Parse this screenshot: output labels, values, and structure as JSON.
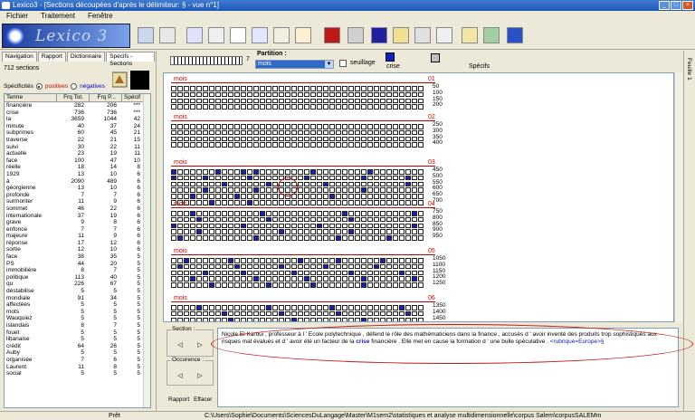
{
  "window": {
    "title": "Lexico3 - [Sections  découpées d'après le délimiteur: § - vue n°1]"
  },
  "menu": [
    "Fichier",
    "Traitement",
    "Fenêtre"
  ],
  "logo": "Lexico 3",
  "side": {
    "tabs": [
      "Navigation",
      "Rapport",
      "Dictionnaire",
      "Spécifs - Sections"
    ],
    "count": "712 sections",
    "spec_label": "Spécificités",
    "positive": "positives",
    "negative": "négatives",
    "headers": [
      "Terme",
      "Frq Tot.",
      "Frq P...",
      "Spécif"
    ],
    "rows": [
      [
        "financière",
        "282",
        "206",
        "***"
      ],
      [
        "crise",
        "736",
        "736",
        "***"
      ],
      [
        "la",
        "3659",
        "1044",
        "42"
      ],
      [
        "minute",
        "40",
        "37",
        "24"
      ],
      [
        "subprimes",
        "60",
        "45",
        "21"
      ],
      [
        "traverse",
        "22",
        "21",
        "15"
      ],
      [
        "suivi",
        "30",
        "22",
        "11"
      ],
      [
        "actuelle",
        "23",
        "19",
        "11"
      ],
      [
        "face",
        "100",
        "47",
        "10"
      ],
      [
        "réelle",
        "18",
        "14",
        "8"
      ],
      [
        "1929",
        "13",
        "10",
        "6"
      ],
      [
        "à",
        "2090",
        "489",
        "6"
      ],
      [
        "géorgienne",
        "13",
        "10",
        "6"
      ],
      [
        "profonde",
        "7",
        "7",
        "6"
      ],
      [
        "surmonter",
        "11",
        "9",
        "6"
      ],
      [
        "sommet",
        "46",
        "22",
        "6"
      ],
      [
        "internationale",
        "37",
        "19",
        "6"
      ],
      [
        "grave",
        "9",
        "8",
        "6"
      ],
      [
        "enfonce",
        "7",
        "7",
        "6"
      ],
      [
        "majeure",
        "11",
        "9",
        "6"
      ],
      [
        "réponse",
        "17",
        "12",
        "6"
      ],
      [
        "sortie",
        "12",
        "10",
        "6"
      ],
      [
        "face",
        "38",
        "35",
        "5"
      ],
      [
        "PS",
        "44",
        "20",
        "5"
      ],
      [
        "immobilière",
        "8",
        "7",
        "5"
      ],
      [
        "politique",
        "113",
        "40",
        "5"
      ],
      [
        "qu",
        "226",
        "67",
        "5"
      ],
      [
        "déstabilise",
        "5",
        "5",
        "5"
      ],
      [
        "mondiale",
        "91",
        "34",
        "5"
      ],
      [
        "affectées",
        "5",
        "5",
        "5"
      ],
      [
        "mots",
        "5",
        "5",
        "5"
      ],
      [
        "Wauquiez",
        "5",
        "5",
        "5"
      ],
      [
        "islandais",
        "8",
        "7",
        "5"
      ],
      [
        "fouet",
        "5",
        "5",
        "5"
      ],
      [
        "libanaise",
        "5",
        "5",
        "5"
      ],
      [
        "crédit",
        "64",
        "26",
        "5"
      ],
      [
        "Auby",
        "5",
        "5",
        "5"
      ],
      [
        "organisée",
        "7",
        "6",
        "5"
      ],
      [
        "Laurent",
        "11",
        "8",
        "5"
      ],
      [
        "social",
        "5",
        "5",
        "5"
      ]
    ]
  },
  "controls": {
    "partition_label": "Partition :",
    "partition_value": "mois",
    "ruler_value": "7",
    "seuillage": "seuillage",
    "crise": "crise",
    "specifs": "Spécifs"
  },
  "months": [
    {
      "name": "mois",
      "num": "01",
      "labels": [
        "50",
        "100",
        "150",
        "200"
      ],
      "blue": []
    },
    {
      "name": "mois",
      "num": "02",
      "labels": [
        "250",
        "300",
        "350",
        "400"
      ],
      "blue": []
    },
    {
      "name": "mois",
      "num": "03",
      "labels": [
        "450",
        "500",
        "550",
        "600",
        "650",
        "700"
      ],
      "blue": [
        0,
        7,
        11,
        13,
        22,
        31,
        40,
        45,
        52,
        61,
        70,
        77,
        88,
        95,
        104,
        117,
        125,
        133,
        150,
        163,
        170,
        185,
        206,
        212
      ]
    },
    {
      "name": "mois",
      "num": "04",
      "labels": [
        "750",
        "800",
        "850",
        "900",
        "950"
      ],
      "blue": [
        3,
        14,
        27,
        38,
        44,
        55,
        68,
        80,
        91,
        103,
        118,
        124,
        137,
        148,
        161,
        173,
        186,
        194
      ]
    },
    {
      "name": "mois",
      "num": "05",
      "labels": [
        "1050",
        "1100",
        "1150",
        "1200",
        "1250"
      ],
      "blue": [
        2,
        9,
        20,
        26,
        33,
        41,
        50,
        57,
        64,
        72,
        85,
        91,
        99,
        108,
        116,
        123,
        133,
        141,
        150,
        158,
        166,
        175,
        182,
        190
      ]
    },
    {
      "name": "mois",
      "num": "06",
      "labels": [
        "1350",
        "1400",
        "1450"
      ],
      "blue": [
        4,
        15,
        25,
        36,
        48,
        57,
        66,
        77,
        89,
        99,
        110
      ]
    }
  ],
  "bottom": {
    "section_label": "Section :",
    "occ_label": "Occurence :",
    "rapport": "Rapport",
    "effacer": "Effacer",
    "context_before": "Nicole El Karoui , professeur à l ' Ecole polytechnique , défend le rôle des mathématiciens dans la finance , accusés d ' avoir inventé des produits trop sophistiqués aux risques mal évalués et d ' avoir été un facteur de la ",
    "context_kw": "crise",
    "context_after": " financière . Elle met en cause la formation d ' une bulle spéculative . ",
    "context_rub": "<rubrique=Europe>§"
  },
  "status": {
    "state": "Prêt",
    "path": "C:\\Users\\Sophie\\Documents\\SciencesDuLangage\\Master\\M1sem2\\statistiques et analyse multidimensionnelle\\corpus Salem\\corpusSALEMm"
  },
  "feuille": "Feuille 1",
  "colors": {
    "accent": "#1a20b8",
    "highlight": "#c41818",
    "title": "#1e58b8"
  }
}
